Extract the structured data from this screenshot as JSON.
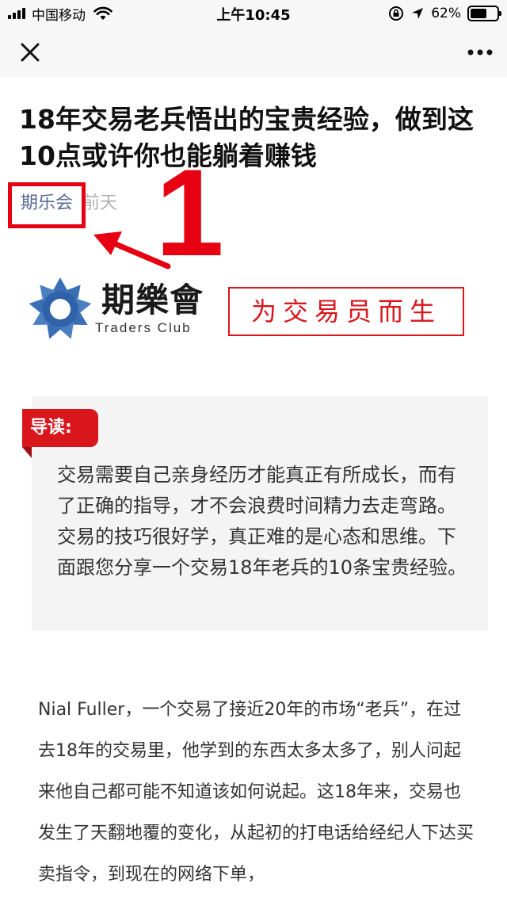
{
  "status_bar": {
    "carrier": "中国移动",
    "time": "上午10:45",
    "battery": "62%",
    "battery_level": 0.62
  },
  "nav": {
    "close_icon": "close-icon",
    "more_icon": "more-dots-icon"
  },
  "article": {
    "title": "18年交易老兵悟出的宝贵经验，做到这10点或许你也能躺着赚钱",
    "author": "期乐会",
    "date": "前天"
  },
  "annotation": {
    "number": "1",
    "color": "#e60012"
  },
  "banner": {
    "logo_cn": "期樂會",
    "logo_en": "Traders Club",
    "slogan": "为交易员而生",
    "logo_color": "#3a6fb5",
    "slogan_color": "#d9161c"
  },
  "intro": {
    "tag": "导读:",
    "text": "交易需要自己亲身经历才能真正有所成长，而有了正确的指导，才不会浪费时间精力去走弯路。交易的技巧很好学，真正难的是心态和思维。下面跟您分享一个交易18年老兵的10条宝贵经验。"
  },
  "body": {
    "paragraph": "Nial Fuller，一个交易了接近20年的市场“老兵”，在过去18年的交易里，他学到的东西太多太多了，别人问起来他自己都可能不知道该如何说起。这18年来，交易也发生了天翻地覆的变化，从起初的打电话给经纪人下达买卖指令，到现在的网络下单，"
  }
}
